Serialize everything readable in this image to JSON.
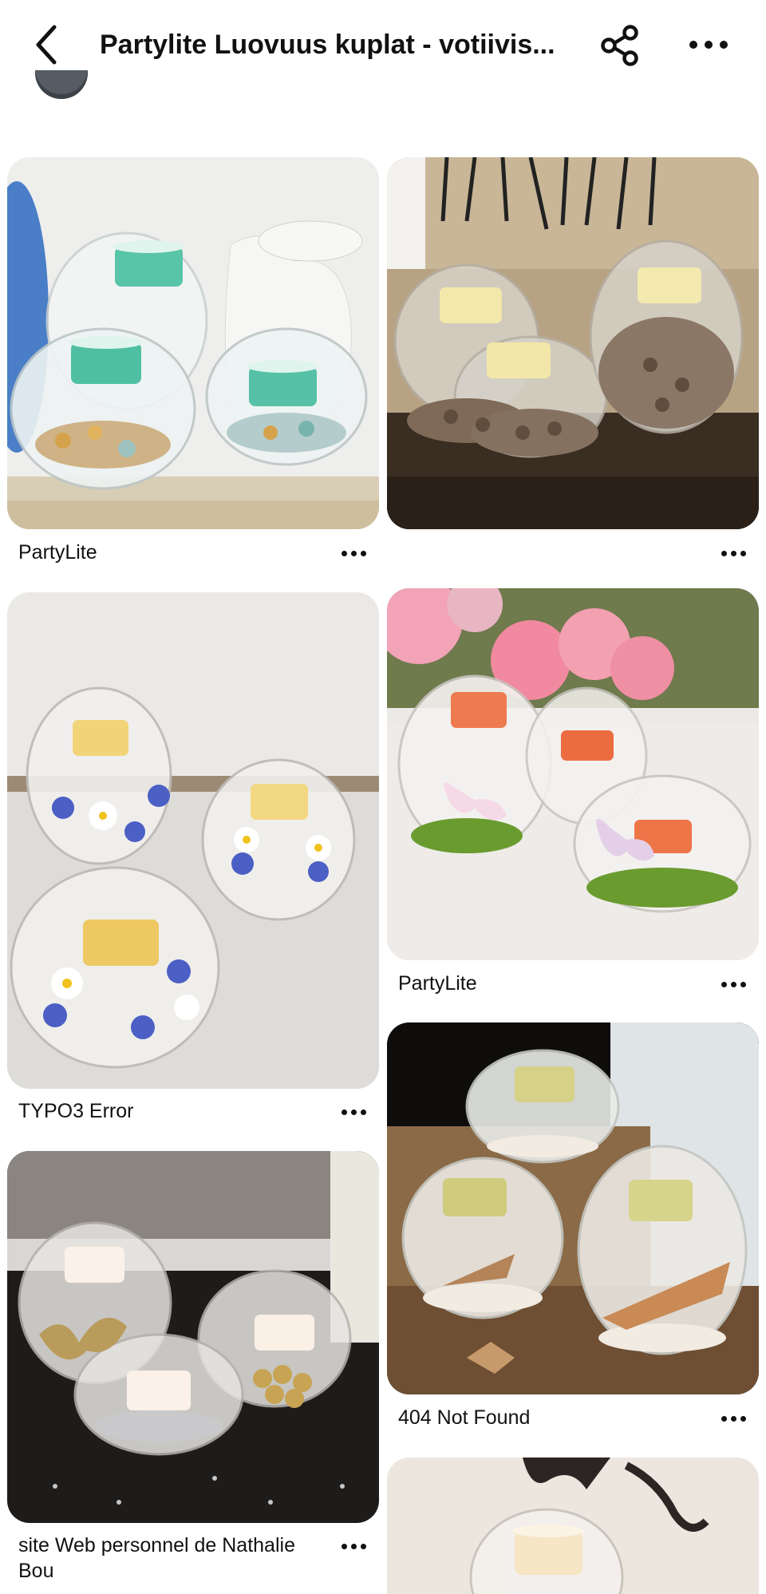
{
  "header": {
    "title": "Partylite Luovuus kuplat - votiivis...",
    "back_icon": "chevron-left-icon",
    "share_icon": "share-icon",
    "more_icon": "ellipsis-icon"
  },
  "pins": [
    {
      "label": "PartyLite",
      "image": "turquoise-tealights-in-glass-bubbles-with-pebbles"
    },
    {
      "label": "",
      "image": "cream-tealights-in-glass-bubbles-with-pinecones"
    },
    {
      "label": "PartyLite",
      "image": "coral-tealights-in-glass-bubbles-with-butterflies-and-moss"
    },
    {
      "label": "TYPO3 Error",
      "image": "yellow-tealights-in-glass-bubbles-with-blue-flowers"
    },
    {
      "label": "404 Not Found",
      "image": "tealights-in-glass-bubbles-with-seashells"
    },
    {
      "label": "site Web personnel de Nathalie Bou",
      "image": "white-tealights-in-glass-bubbles-with-gold-ornaments"
    },
    {
      "label": "",
      "image": "glass-bubble-with-tealight-and-iron-candleholder"
    }
  ],
  "colors": {
    "text": "#111111",
    "background": "#ffffff"
  }
}
